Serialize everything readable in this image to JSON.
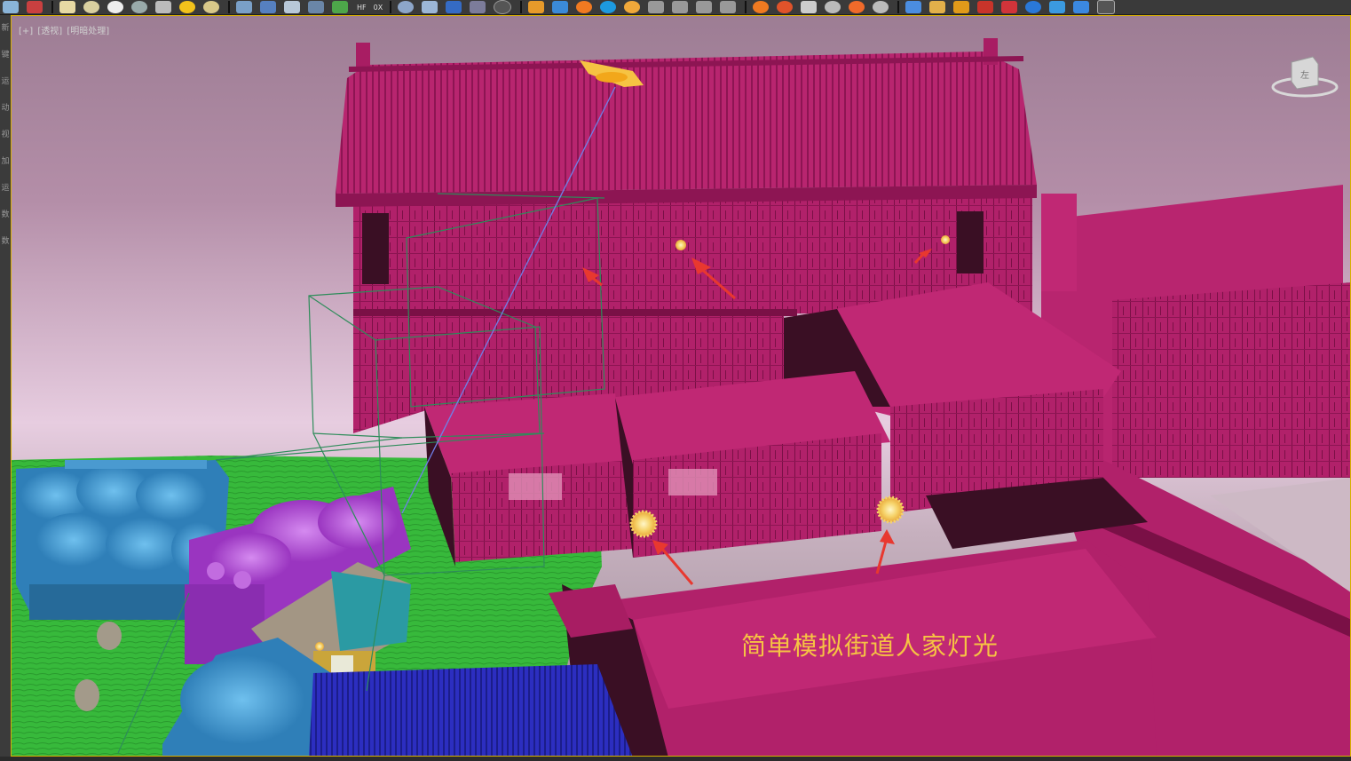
{
  "toolbar": {
    "hf_label": "HF",
    "ox_label": "0X"
  },
  "viewport": {
    "labels": [
      "[+]",
      "[透视]",
      "[明暗处理]"
    ],
    "caption": "简单模拟街道人家灯光",
    "viewcube_face": "左"
  },
  "left_strip": {
    "glyphs": [
      "新",
      "键",
      "运",
      "动",
      "视",
      "加",
      "运",
      "数",
      "数"
    ]
  },
  "colors": {
    "building": "#b8256f",
    "building_dark": "#8d1553",
    "shadow": "#3a0f24",
    "grass": "#37b93b",
    "blue_house": "#2f7fb8",
    "purple_house": "#a544c8",
    "teal_roof": "#2b9aa3",
    "blue_roof": "#2c2ec0",
    "light": "#f6d36a",
    "arrow": "#e8382f",
    "caption": "#f6c343",
    "wire": "#2e8c5a"
  }
}
